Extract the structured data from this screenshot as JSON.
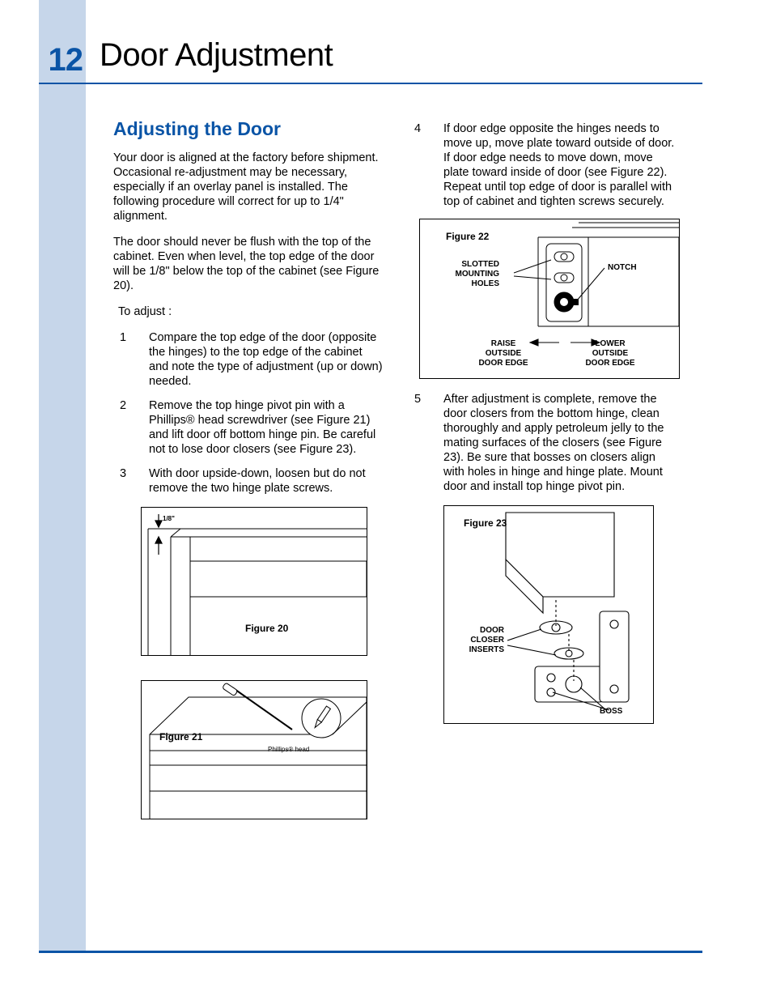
{
  "page_number": "12",
  "page_title": "Door Adjustment",
  "section_heading": "Adjusting the Door",
  "intro_p1": "Your door is aligned at the factory before shipment. Occasional re-adjustment may be necessary, especially if an overlay panel is installed. The following procedure will correct for up to 1/4\" alignment.",
  "intro_p2": "The door should never be flush with the top of the cabinet. Even when level, the top edge of the door will be 1/8\" below the top of the cabinet (see Figure 20).",
  "to_adjust": "To adjust :",
  "steps": {
    "s1_num": "1",
    "s1": "Compare the top edge of the door (opposite the hinges) to the top edge of the cabinet and note the type of adjustment (up or down) needed.",
    "s2_num": "2",
    "s2": "Remove the top hinge pivot pin with a Phillips® head screwdriver (see Figure 21) and lift door off bottom hinge pin. Be careful not to lose door closers (see Figure 23).",
    "s3_num": "3",
    "s3": "With door upside-down, loosen but do not remove the two hinge plate screws.",
    "s4_num": "4",
    "s4": "If door edge opposite the hinges needs to move up, move plate toward outside of door. If door edge needs to move down, move plate toward inside of door (see Figure 22). Repeat until top edge of door is parallel with top of cabinet and tighten screws securely.",
    "s5_num": "5",
    "s5": "After adjustment is complete, remove the door closers from the bottom hinge, clean thoroughly and apply petroleum jelly to the mating surfaces of  the closers (see Figure 23). Be sure that bosses on closers align with holes in hinge and hinge plate. Mount door and install top hinge pivot pin."
  },
  "fig20": {
    "label": "Figure 20",
    "dim": "1/8\""
  },
  "fig21": {
    "label": "Figure 21",
    "note": "Phillips® head"
  },
  "fig22": {
    "label": "Figure 22",
    "slotted": "SLOTTED MOUNTING HOLES",
    "notch": "NOTCH",
    "raise": "RAISE OUTSIDE DOOR EDGE",
    "lower": "LOWER OUTSIDE DOOR EDGE"
  },
  "fig23": {
    "label": "Figure 23",
    "closer": "DOOR CLOSER INSERTS",
    "boss": "BOSS"
  }
}
